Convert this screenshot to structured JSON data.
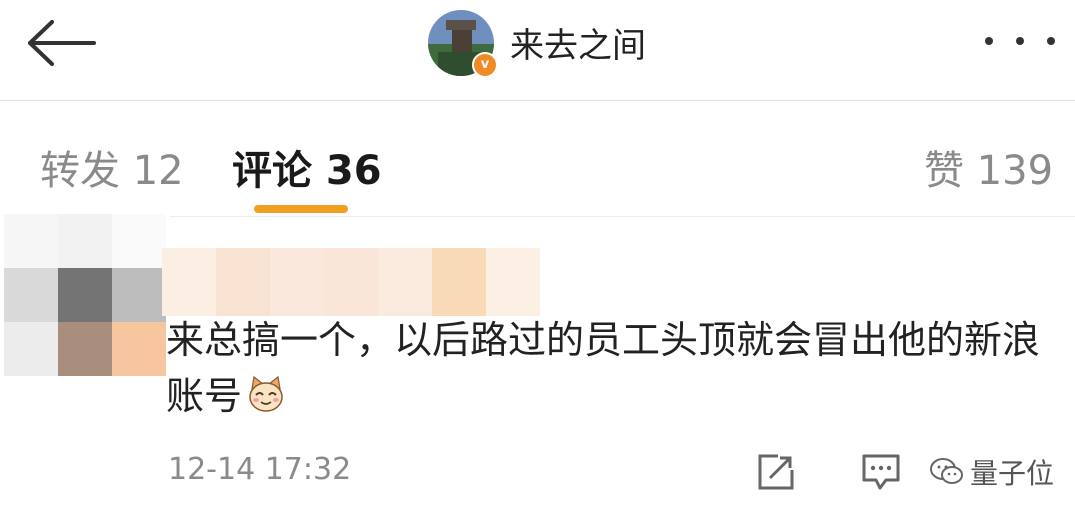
{
  "header": {
    "back_icon": "arrow-left-icon",
    "username": "来去之间",
    "verified_badge": "v",
    "more_icon": "more-dots-icon"
  },
  "tabs": [
    {
      "label": "转发 12",
      "active": false
    },
    {
      "label": "评论 36",
      "active": true
    },
    {
      "label": "赞 139",
      "active": false
    }
  ],
  "colors": {
    "accent": "#f0a020",
    "badge": "#f08a24",
    "muted_text": "#8a8a8a"
  },
  "comment": {
    "text": "来总搞一个，以后路过的员工头顶就会冒出他的新浪账号",
    "emoji_icon": "cat-face-emoji-icon",
    "time": "12-14 17:32",
    "share_icon": "share-external-icon",
    "reply_icon": "comment-reply-icon"
  },
  "watermark": {
    "icon": "wechat-icon",
    "text": "量子位"
  }
}
